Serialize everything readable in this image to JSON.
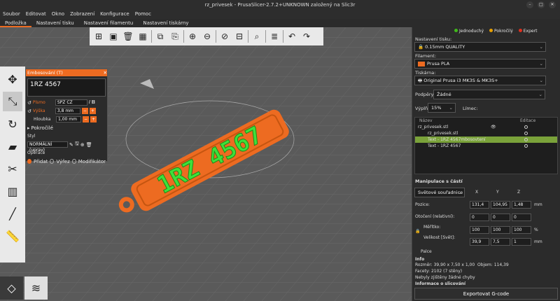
{
  "window": {
    "title": "rz_privesek - PrusaSlicer-2.7.2+UNKNOWN založený na Slic3r"
  },
  "menu": [
    "Soubor",
    "Editovat",
    "Okno",
    "Zobrazení",
    "Konfigurace",
    "Pomoc"
  ],
  "tabs": [
    "Podložka",
    "Nastavení tisku",
    "Nastavení filamentu",
    "Nastavení tiskárny"
  ],
  "emboss": {
    "title": "Embosování (T)",
    "text": "1RZ 4567",
    "font_label": "Písmo",
    "font_value": "SPZ CZ",
    "height_label": "Výška",
    "height_value": "3,8 mm",
    "depth_label": "Hloubka",
    "depth_value": "1,00 mm",
    "advanced": "Pokročilé",
    "style_label": "Styl",
    "style_value": "NORMÁLNÍ (uprav)",
    "ops_label": "Operace",
    "ops": [
      "Přidat",
      "Výřez",
      "Modifikátor"
    ]
  },
  "model": {
    "text": "1RZ 4567"
  },
  "modes": {
    "simple": "Jednoduchý",
    "advanced": "Pokročilý",
    "expert": "Expert",
    "simple_color": "#3fb91a",
    "advanced_color": "#e8a000",
    "expert_color": "#e0301e"
  },
  "print": {
    "label": "Nastavení tisku:",
    "value": "0.15mm QUALITY"
  },
  "filament": {
    "label": "Filament:",
    "value": "Prusa PLA",
    "color": "#ed6b21"
  },
  "printer": {
    "label": "Tiskárna:",
    "value": "Original Prusa i3 MK3S & MK3S+"
  },
  "supports": {
    "label": "Podpěry:",
    "value": "Žádné"
  },
  "infill": {
    "label": "Výplň:",
    "value": "15%",
    "brim": "Límec:"
  },
  "tree": {
    "col_name": "Název",
    "col_edit": "Editace",
    "rows": [
      "rz_privesek.stl",
      "rz_privesek.stl",
      "Text - 1RZ 4567mbosovtení",
      "Text - 1RZ 4567"
    ]
  },
  "manip": {
    "title": "Manipulace s částí",
    "coord": "Světové souřadnice",
    "x": "X",
    "y": "Y",
    "z": "Z",
    "pos_label": "Pozice:",
    "pos": [
      "131,4",
      "104,95",
      "1,48"
    ],
    "pos_unit": "mm",
    "rot_label": "Otočení (relativní):",
    "rot": [
      "0",
      "0",
      "0"
    ],
    "scale_label": "Měřítko:",
    "scale": [
      "100",
      "100",
      "100"
    ],
    "scale_unit": "%",
    "size_label": "Velikost [Svět]:",
    "size": [
      "39,9",
      "7,5",
      "1"
    ],
    "size_unit": "mm",
    "inches": "Palce"
  },
  "info": {
    "title": "Info",
    "size_label": "Rozměr:",
    "size": "39,90 x 7,50 x 1,00",
    "vol_label": "Objem:",
    "vol": "114,39",
    "facets_label": "Facety:",
    "facets": "2102 (7 stěny)",
    "errors": "Nebyly zjištěny žádné chyby",
    "slice_title": "Informace o slicování"
  },
  "export": "Exportovat G-code"
}
